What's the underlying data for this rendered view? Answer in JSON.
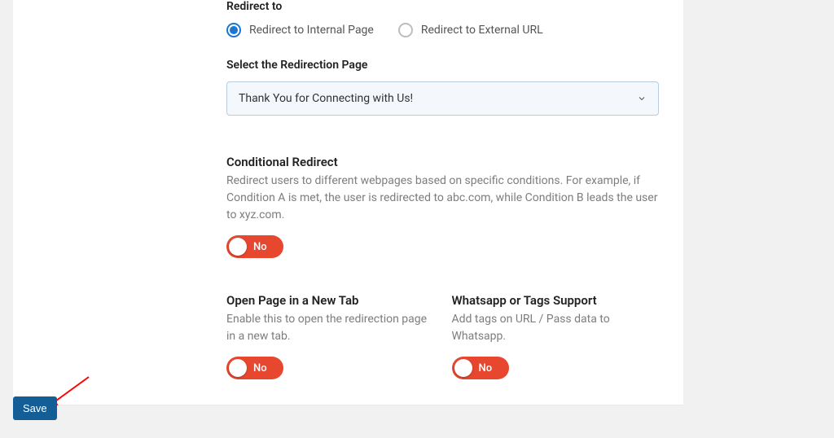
{
  "redirect": {
    "heading": "Redirect to",
    "options": {
      "internal": "Redirect to Internal Page",
      "external": "Redirect to External URL"
    },
    "selected": "internal"
  },
  "selectPage": {
    "label": "Select the Redirection Page",
    "value": "Thank You for Connecting with Us!"
  },
  "conditional": {
    "title": "Conditional Redirect",
    "desc": "Redirect users to different webpages based on specific conditions. For example, if Condition A is met, the user is redirected to abc.com, while Condition B leads the user to xyz.com.",
    "state": "No"
  },
  "newtab": {
    "title": "Open Page in a New Tab",
    "desc": "Enable this to open the redirection page in a new tab.",
    "state": "No"
  },
  "whatsapp": {
    "title": "Whatsapp or Tags Support",
    "desc": "Add tags on URL / Pass data to Whatsapp.",
    "state": "No"
  },
  "saveLabel": "Save"
}
